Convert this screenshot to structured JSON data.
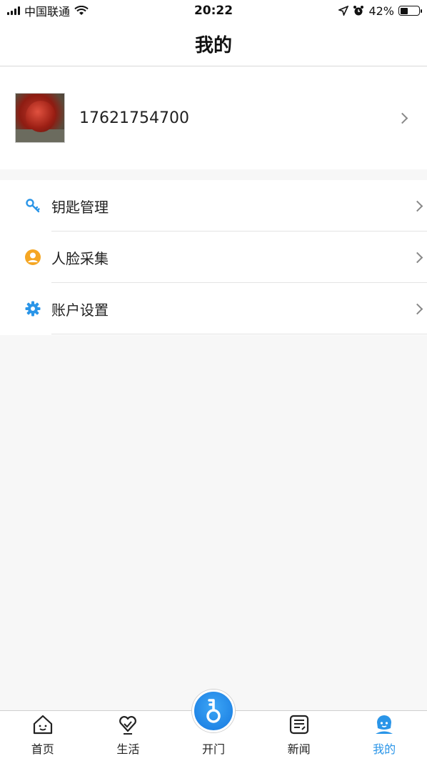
{
  "status_bar": {
    "carrier": "中国联通",
    "time": "20:22",
    "battery_percent": "42%",
    "battery_level": 0.42,
    "icons": [
      "signal-icon",
      "wifi-icon",
      "location-icon",
      "alarm-icon",
      "battery-icon"
    ]
  },
  "nav": {
    "title": "我的"
  },
  "profile": {
    "phone": "17621754700"
  },
  "menu": {
    "items": [
      {
        "label": "钥匙管理",
        "icon": "key-icon",
        "color": "#2a95e8"
      },
      {
        "label": "人脸采集",
        "icon": "face-icon",
        "color": "#f5a623"
      },
      {
        "label": "账户设置",
        "icon": "gear-icon",
        "color": "#2a95e8"
      }
    ]
  },
  "tabbar": {
    "items": [
      {
        "label": "首页",
        "icon": "home-icon"
      },
      {
        "label": "生活",
        "icon": "life-heart-icon"
      },
      {
        "label": "开门",
        "icon": "key-open-icon"
      },
      {
        "label": "新闻",
        "icon": "news-icon"
      },
      {
        "label": "我的",
        "icon": "profile-icon",
        "active": true
      }
    ],
    "active_color": "#2a95e8"
  }
}
